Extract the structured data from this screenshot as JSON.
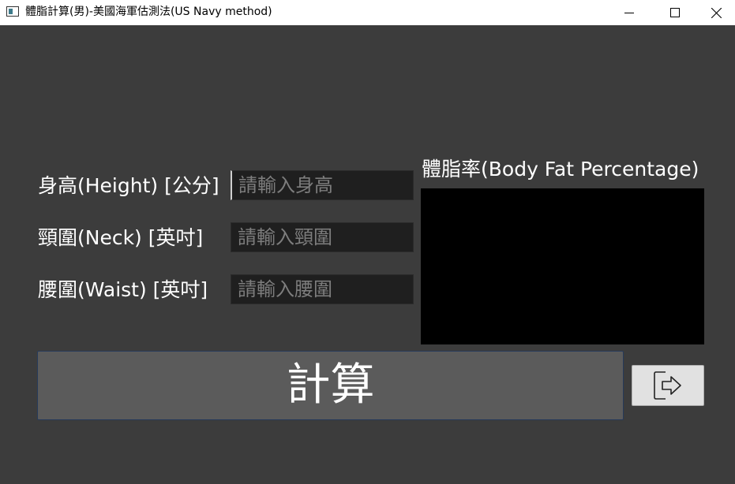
{
  "window": {
    "title": "體脂計算(男)-美國海軍估測法(US Navy method)",
    "app_icon": "app-window-icon",
    "controls": [
      "minimize-icon",
      "maximize-icon",
      "close-icon"
    ]
  },
  "form": {
    "height": {
      "label": "身高(Height) [公分]",
      "placeholder": "請輸入身高",
      "value": ""
    },
    "neck": {
      "label": "頸圍(Neck) [英吋]",
      "placeholder": "請輸入頸圍",
      "value": ""
    },
    "waist": {
      "label": "腰圍(Waist) [英吋]",
      "placeholder": "請輸入腰圍",
      "value": ""
    }
  },
  "result": {
    "title": "體脂率(Body Fat Percentage)",
    "value": ""
  },
  "actions": {
    "calculate_label": "計算",
    "exit_icon": "exit-icon"
  },
  "colors": {
    "background": "#3c3c3c",
    "input_background": "#1f1f1f",
    "result_background": "#000000",
    "button_background": "#5b5b5b",
    "text": "#ffffff"
  }
}
